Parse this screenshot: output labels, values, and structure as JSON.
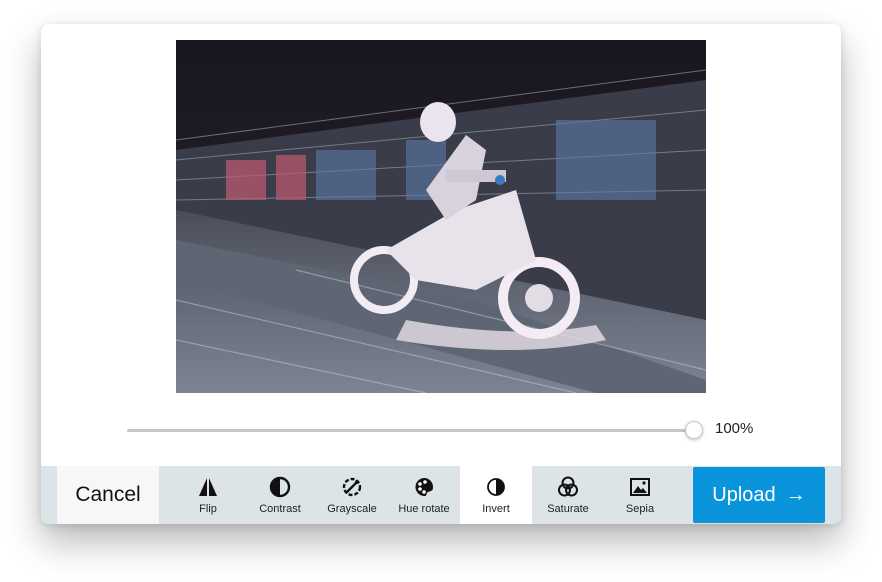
{
  "editor": {
    "slider": {
      "value_label": "100%",
      "value": 1.0
    },
    "cancel_label": "Cancel",
    "upload_label": "Upload",
    "upload_icon": "arrow-right-icon",
    "tools": [
      {
        "label": "Flip",
        "icon": "flip-icon",
        "active": false
      },
      {
        "label": "Contrast",
        "icon": "contrast-icon",
        "active": false
      },
      {
        "label": "Grayscale",
        "icon": "grayscale-icon",
        "active": false
      },
      {
        "label": "Hue rotate",
        "icon": "palette-icon",
        "active": false
      },
      {
        "label": "Invert",
        "icon": "invert-icon",
        "active": true
      },
      {
        "label": "Saturate",
        "icon": "saturate-icon",
        "active": false
      },
      {
        "label": "Sepia",
        "icon": "image-icon",
        "active": false
      }
    ],
    "colors": {
      "accent": "#0a94dc",
      "toolbar": "#dde4e8",
      "active_tool": "#ffffff"
    }
  }
}
